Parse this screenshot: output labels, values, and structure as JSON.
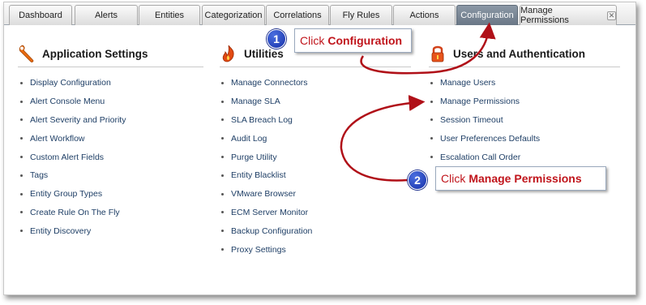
{
  "tabs": [
    {
      "label": "Dashboard",
      "active": false
    },
    {
      "label": "Alerts",
      "active": false
    },
    {
      "label": "Entities",
      "active": false
    },
    {
      "label": "Categorization",
      "active": false
    },
    {
      "label": "Correlations",
      "active": false
    },
    {
      "label": "Fly Rules",
      "active": false
    },
    {
      "label": "Actions",
      "active": false
    },
    {
      "label": "Configuration",
      "active": true
    },
    {
      "label": "Manage Permissions",
      "active": false,
      "closable": true
    }
  ],
  "sections": {
    "app_settings": {
      "title": "Application Settings",
      "icon": "wrench-icon",
      "items": [
        "Display Configuration",
        "Alert Console Menu",
        "Alert Severity and Priority",
        "Alert Workflow",
        "Custom Alert Fields",
        "Tags",
        "Entity Group Types",
        "Create Rule On The Fly",
        "Entity Discovery"
      ]
    },
    "utilities": {
      "title": "Utilities",
      "icon": "tools-flame-icon",
      "items": [
        "Manage Connectors",
        "Manage SLA",
        "SLA Breach Log",
        "Audit Log",
        "Purge Utility",
        "Entity Blacklist",
        "VMware Browser",
        "ECM Server Monitor",
        "Backup Configuration",
        "Proxy Settings"
      ]
    },
    "users_auth": {
      "title": "Users and Authentication",
      "icon": "padlock-icon",
      "items": [
        "Manage Users",
        "Manage Permissions",
        "Session Timeout",
        "User Preferences Defaults",
        "Escalation Call Order"
      ]
    }
  },
  "callouts": {
    "step1": {
      "number": "1",
      "prefix": "Click",
      "target": "Configuration"
    },
    "step2": {
      "number": "2",
      "prefix": "Click",
      "target": "Manage Permissions"
    }
  },
  "colors": {
    "accent_red": "#c0141b",
    "badge_blue": "#1630a8",
    "active_tab": "#7a8796",
    "link_text": "#1f3f66"
  }
}
